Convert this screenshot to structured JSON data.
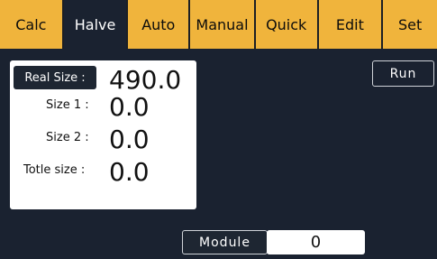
{
  "tabs": [
    {
      "label": "Calc"
    },
    {
      "label": "Halve"
    },
    {
      "label": "Auto"
    },
    {
      "label": "Manual"
    },
    {
      "label": "Quick"
    },
    {
      "label": "Edit"
    },
    {
      "label": "Set"
    }
  ],
  "active_tab": "Halve",
  "panel": {
    "real_size_label": "Real Size :",
    "real_size_value": "490.0",
    "size1_label": "Size 1 :",
    "size1_value": "0.0",
    "size2_label": "Size 2 :",
    "size2_value": "0.0",
    "totle_label": "Totle size :",
    "totle_value": "0.0"
  },
  "run_label": "Run",
  "module": {
    "label": "Module",
    "value": "0"
  },
  "colors": {
    "background": "#1a2230",
    "tab": "#f0b43c",
    "panel": "#ffffff"
  }
}
